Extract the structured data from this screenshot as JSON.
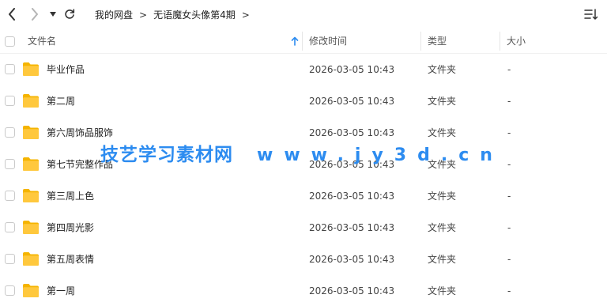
{
  "toolbar": {
    "icons": {
      "back": "chevron-left-icon",
      "forward": "chevron-right-icon",
      "history": "caret-down-icon",
      "refresh": "refresh-icon",
      "sort": "sort-list-icon"
    },
    "breadcrumb": [
      "我的网盘",
      "无语魔女头像第4期"
    ],
    "breadcrumb_sep": ">"
  },
  "table": {
    "columns": {
      "name": "文件名",
      "modified": "修改时间",
      "type": "类型",
      "size": "大小"
    },
    "sort": {
      "column": "name",
      "direction": "ascending",
      "icon": "arrow-up-icon"
    },
    "rows": [
      {
        "name": "毕业作品",
        "modified": "2026-03-05 10:43",
        "type": "文件夹",
        "size": "-"
      },
      {
        "name": "第二周",
        "modified": "2026-03-05 10:43",
        "type": "文件夹",
        "size": "-"
      },
      {
        "name": "第六周饰品服饰",
        "modified": "2026-03-05 10:43",
        "type": "文件夹",
        "size": "-"
      },
      {
        "name": "第七节完整作品",
        "modified": "2026-03-05 10:43",
        "type": "文件夹",
        "size": "-"
      },
      {
        "name": "第三周上色",
        "modified": "2026-03-05 10:43",
        "type": "文件夹",
        "size": "-"
      },
      {
        "name": "第四周光影",
        "modified": "2026-03-05 10:43",
        "type": "文件夹",
        "size": "-"
      },
      {
        "name": "第五周表情",
        "modified": "2026-03-05 10:43",
        "type": "文件夹",
        "size": "-"
      },
      {
        "name": "第一周",
        "modified": "2026-03-05 10:43",
        "type": "文件夹",
        "size": "-"
      }
    ]
  },
  "watermark": {
    "site": "技艺学习素材网",
    "url": "www.jy3d.cn"
  },
  "colors": {
    "folder": "#FFC83D",
    "folder_back": "#F5B400",
    "accent": "#2D8CF0",
    "watermark": "#2D8CF0"
  }
}
